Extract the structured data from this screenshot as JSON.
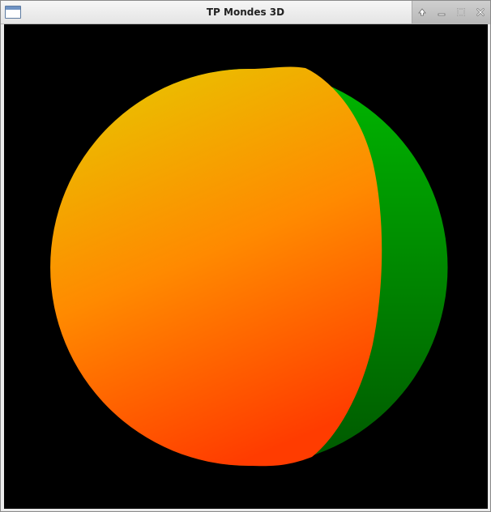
{
  "window": {
    "title": "TP Mondes 3D",
    "icons": {
      "app": "window-icon",
      "up": "arrow-up-icon",
      "minimize": "minimize-icon",
      "maximize": "maximize-icon",
      "close": "close-icon"
    }
  },
  "scene": {
    "background": "#000000",
    "object": "sphere",
    "colors": {
      "front_top": "#e8c400",
      "front_mid": "#ff8a00",
      "front_bottom": "#ff3c00",
      "side_top": "#00b800",
      "side_bottom": "#005800"
    }
  }
}
